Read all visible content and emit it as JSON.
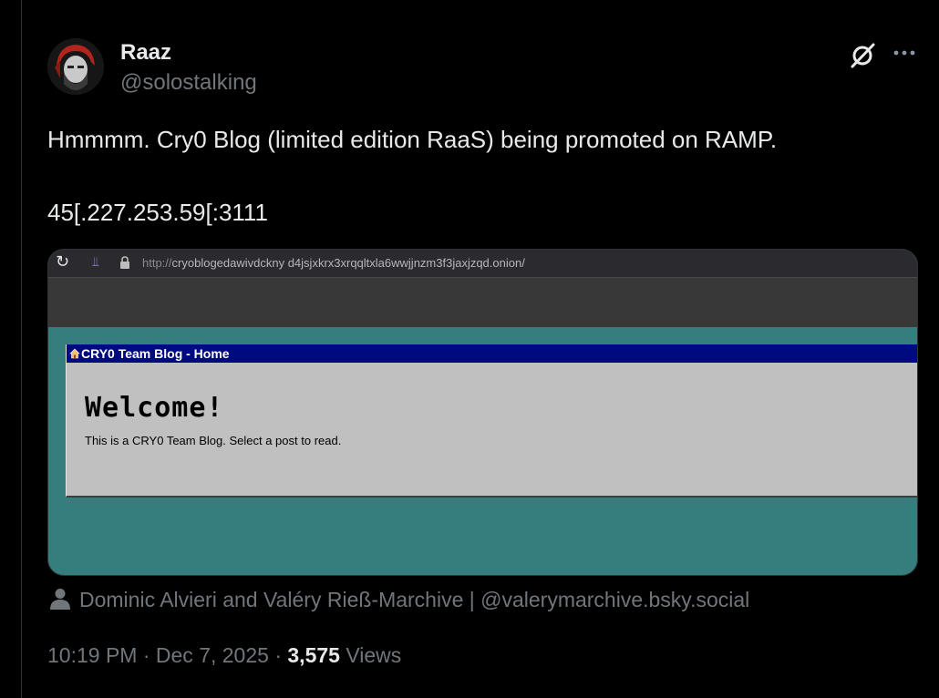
{
  "author": {
    "display_name": "Raaz",
    "handle": "@solostalking"
  },
  "tweet": {
    "text": "Hmmmm. Cry0 Blog (limited edition RaaS) being promoted on RAMP.",
    "ip": "45[.227.253.59[:3111"
  },
  "media": {
    "browser_url_proto": "http://",
    "browser_url_rest": "cryoblogedawivdckny d4jsjxkrx3xrqqltxla6wwjjnzm3f3jaxjzqd.onion/",
    "window_title": "CRY0 Team Blog - Home",
    "welcome_heading": "Welcome!",
    "welcome_text": "This is a CRY0 Team Blog. Select a post to read."
  },
  "credit": {
    "text": "Dominic Alvieri and Valéry Rieß-Marchive | @valerymarchive.bsky.social"
  },
  "meta": {
    "time": "10:19 PM",
    "separator1": " · ",
    "date": "Dec 7, 2025",
    "separator2": " · ",
    "views_count": "3,575",
    "views_label": " Views"
  },
  "icons": {
    "grok": "grok-icon",
    "more": "more-icon",
    "person": "person-icon"
  },
  "colors": {
    "background": "#000000",
    "text": "#e7e9ea",
    "muted": "#71767b",
    "media_teal": "#367e7d",
    "win_title_bar": "#000a80",
    "win_body": "#c0c0c0"
  }
}
